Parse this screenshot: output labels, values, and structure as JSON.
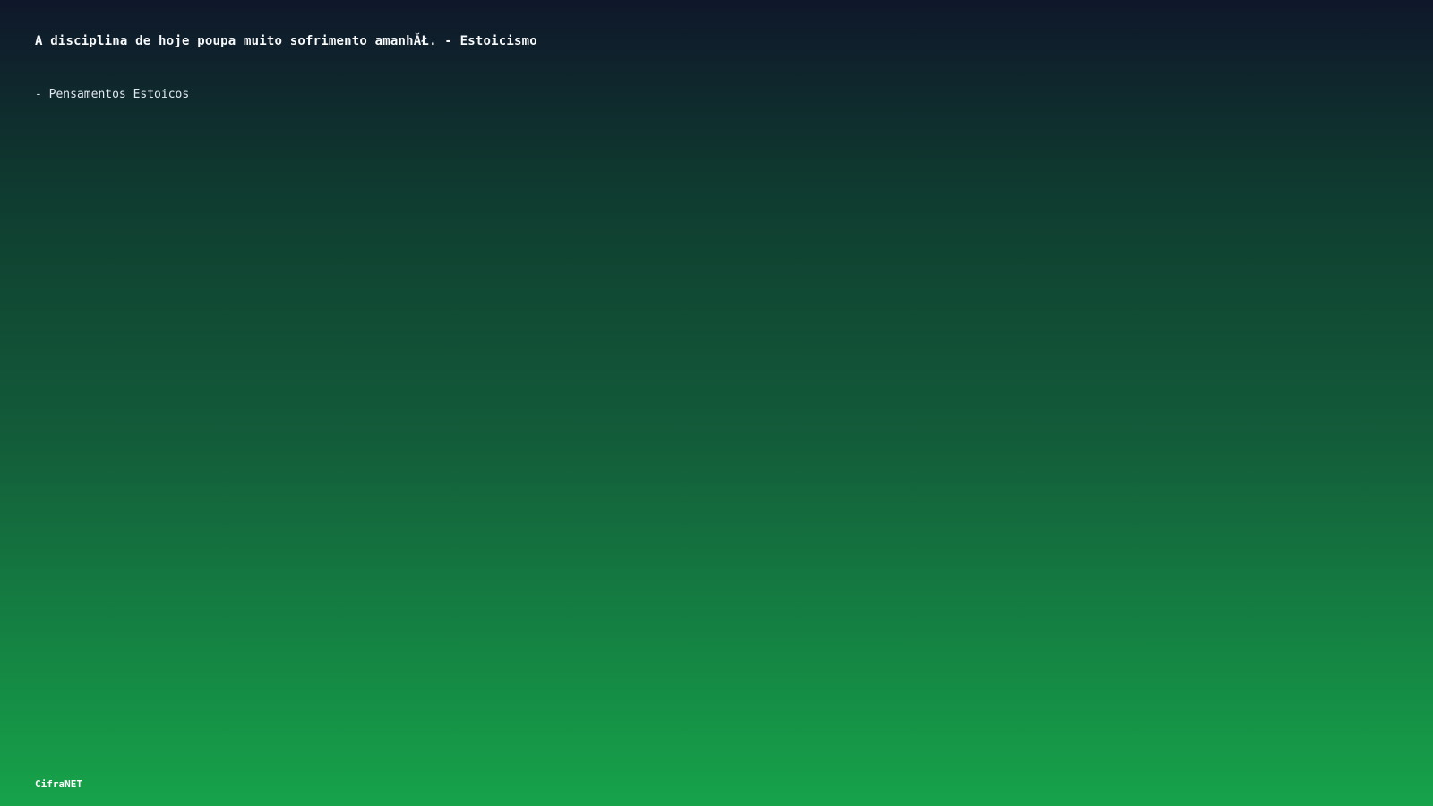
{
  "quote": {
    "text": "A disciplina de hoje poupa muito sofrimento amanhĂŁ. - Estoicismo",
    "author": "- Pensamentos Estoicos"
  },
  "footer": {
    "brand": "CifraNET"
  },
  "colors": {
    "gradient_top": "#0f172a",
    "gradient_bottom": "#16a34a",
    "text": "#ffffff"
  }
}
